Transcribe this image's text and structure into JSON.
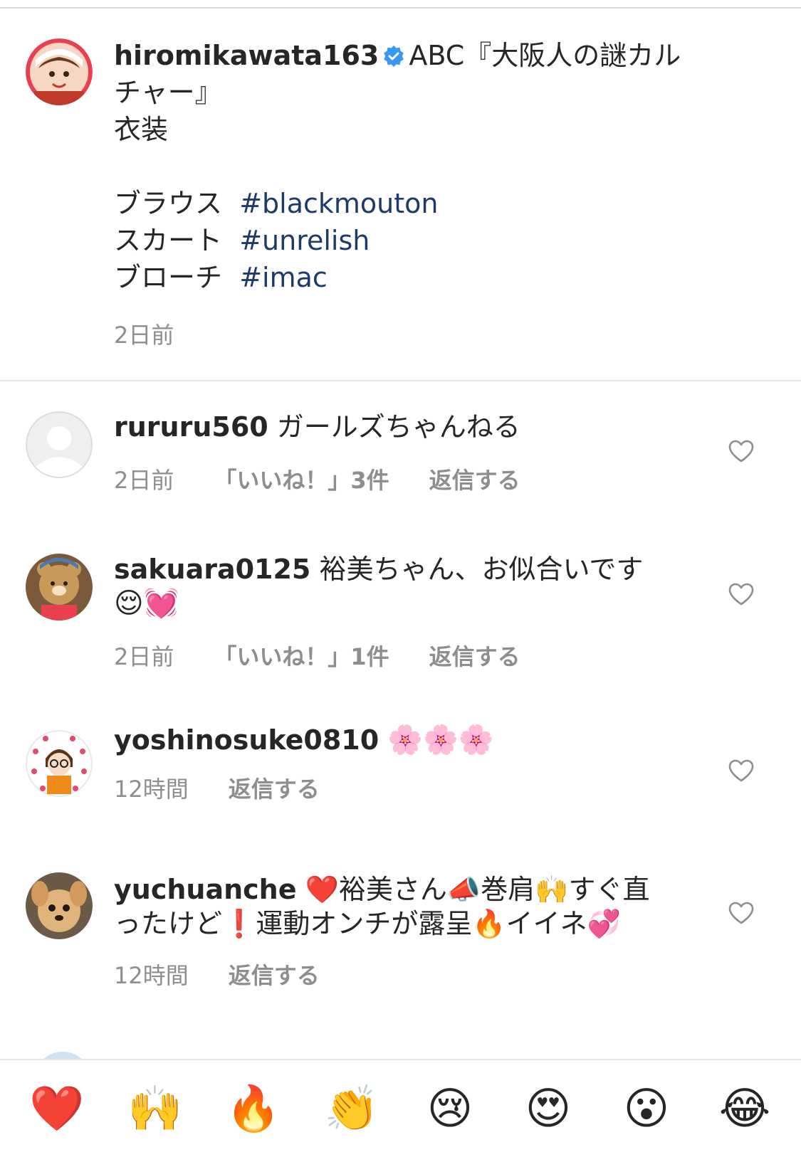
{
  "post": {
    "username": "hiromikawata163",
    "title_line1": "ABC『大阪人の謎カル",
    "title_line2": "チャー』",
    "line3": "衣装",
    "items": [
      {
        "label": "ブラウス",
        "tag": "#blackmouton"
      },
      {
        "label": "スカート",
        "tag": "#unrelish"
      },
      {
        "label": "ブローチ",
        "tag": "#imac"
      }
    ],
    "time": "2日前"
  },
  "comments": [
    {
      "username": "rururu560",
      "text": "ガールズちゃんねる",
      "time": "2日前",
      "likes": "「いいね！」3件",
      "reply": "返信する"
    },
    {
      "username": "sakuara0125",
      "text": "裕美ちゃん、お似合いです",
      "emoji_line": "😌💓",
      "time": "2日前",
      "likes": "「いいね！」1件",
      "reply": "返信する"
    },
    {
      "username": "yoshinosuke0810",
      "text": "🌸🌸🌸",
      "time": "12時間",
      "reply": "返信する"
    },
    {
      "username": "yuchuanche",
      "line1": "❤️裕美さん📣巻肩🙌すぐ直",
      "line2": "ったけど❗️運動オンチが露呈🔥イイネ💞",
      "time": "12時間",
      "reply": "返信する"
    }
  ],
  "emoji_bar": {
    "items": [
      {
        "glyph": "❤️",
        "name": "red-heart"
      },
      {
        "glyph": "🙌",
        "name": "raising-hands"
      },
      {
        "glyph": "🔥",
        "name": "fire"
      },
      {
        "glyph": "👏",
        "name": "clapping-hands"
      },
      {
        "glyph": "😢",
        "name": "crying-face"
      },
      {
        "glyph": "😍",
        "name": "heart-eyes"
      },
      {
        "glyph": "😮",
        "name": "surprised-face"
      },
      {
        "glyph": "😂",
        "name": "tears-of-joy"
      }
    ]
  },
  "colors": {
    "hashtag": "#1e3a6b",
    "secondary_text": "#8e8e8e",
    "verified": "#3897f0"
  }
}
